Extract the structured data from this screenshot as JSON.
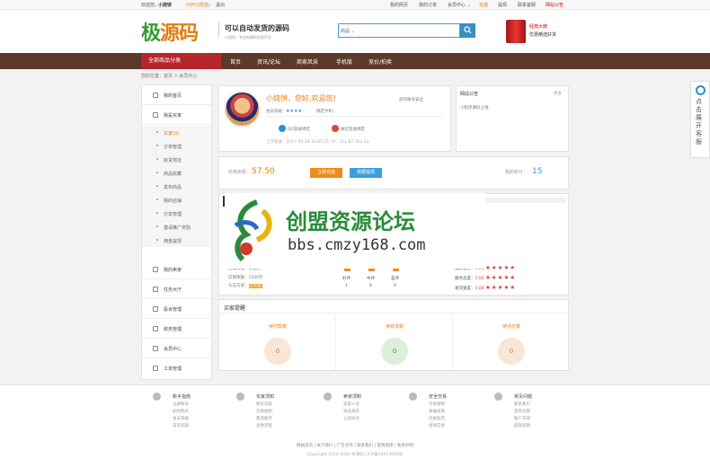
{
  "topbar": {
    "welcome": "欢迎您，",
    "username": "小烧饼",
    "unread": "(0开口短信)",
    "logout": "退出",
    "links": [
      "我的网页",
      "我的订单",
      "会员中心 ⌄",
      "充值",
      "提现",
      "联系客服",
      "网站公告"
    ]
  },
  "header": {
    "logo_main": "极",
    "logo_accent": "源码",
    "slogan": "可以自动发货的源码",
    "slogan_sub": "小程序 · 专业的源码交易平台",
    "search_placeholder": "商品 ⌄",
    "ad_line1": "经典大牌",
    "ad_line2": "优惠精选好货"
  },
  "nav": {
    "all": "全部商品分类",
    "items": [
      "首页",
      "资讯/论坛",
      "商家风采",
      "手机版",
      "竞价/拍卖"
    ]
  },
  "breadcrumb": "您的位置：首页 > 会员中心",
  "sidebar": {
    "items": [
      {
        "label": "我的首页"
      },
      {
        "label": "我是买家"
      }
    ],
    "subs": [
      "买家(0)",
      "订单管理",
      "收货地址",
      "商品收藏",
      "发布商品",
      "我的店铺",
      "分享管理",
      "邀请推广奖励",
      "佣金提现"
    ],
    "more": [
      "我的卖家",
      "任务大厅",
      "投诉管理",
      "财务管理",
      "会员中心",
      "工单管理"
    ]
  },
  "profile": {
    "welcome": "小烧饼，您好,欢迎您！",
    "level_label": "会员等级：",
    "bind_label": "绑定手机：",
    "qq_bind": "QQ登录绑定",
    "wx_bind": "微信登录绑定",
    "last_login": "上次登录：2017-05-20 16:05:21",
    "ip": "IP：111.87.162.33",
    "right_tag": "您的账号安全"
  },
  "news": {
    "title": "网站公告",
    "more": "更多",
    "item1": "小程序源码上线"
  },
  "funds": {
    "balance_label": "可用余额：",
    "balance_value": "57.50",
    "recharge": "立即充值",
    "withdraw": "我要提现",
    "points_label": "我的积分：",
    "points_value": "15"
  },
  "orders": {
    "col1": [
      {
        "label": "店铺等级：",
        "value": "普通店"
      },
      {
        "label": "店铺余额：",
        "value": "1200元"
      },
      {
        "label": "认证方式：",
        "value": "已认证"
      }
    ],
    "counts": [
      {
        "label": "好评",
        "value": "1"
      },
      {
        "label": "中评",
        "value": "0"
      },
      {
        "label": "差评",
        "value": "0"
      }
    ],
    "ratings": [
      {
        "label": "描述相符：",
        "score": "5.00"
      },
      {
        "label": "服务态度：",
        "score": "5.00"
      },
      {
        "label": "发货速度：",
        "score": "5.00"
      }
    ]
  },
  "watermark": {
    "title": "创盟资源论坛",
    "url": "bbs.cmzy168.com"
  },
  "stats": {
    "title": "买家提醒",
    "cols": [
      {
        "label": "待付款数",
        "value": "0",
        "color": "#f9e6d6",
        "text": "#e07b2a"
      },
      {
        "label": "待收货数",
        "value": "0",
        "color": "#dcefd9",
        "text": "#3a9a31"
      },
      {
        "label": "待评价数",
        "value": "0",
        "color": "#f9e6d6",
        "text": "#e07b2a"
      }
    ]
  },
  "footer": {
    "cols": [
      {
        "title": "新手指南",
        "links": [
          "注册账号",
          "如何购买",
          "会员等级",
          "常见问题"
        ]
      },
      {
        "title": "买家须知",
        "links": [
          "购买流程",
          "交易规则",
          "售后服务",
          "退款流程"
        ]
      },
      {
        "title": "卖家须知",
        "links": [
          "卖家入驻",
          "商品发布",
          "入驻协议"
        ]
      },
      {
        "title": "安全交易",
        "links": [
          "交易保障",
          "防骗指南",
          "违规处罚",
          "担保交易"
        ]
      },
      {
        "title": "常见问题",
        "links": [
          "联系我们",
          "常见问题",
          "账户充值",
          "提现说明"
        ]
      }
    ],
    "links": "网站首页 | 关于我们 | 广告合作 | 联系我们 | 友情链接 | 免责声明",
    "copyright": "Copyright 2014-2020 永源码 | ICP备16013550号"
  },
  "service": {
    "text": "点击展开客服"
  }
}
